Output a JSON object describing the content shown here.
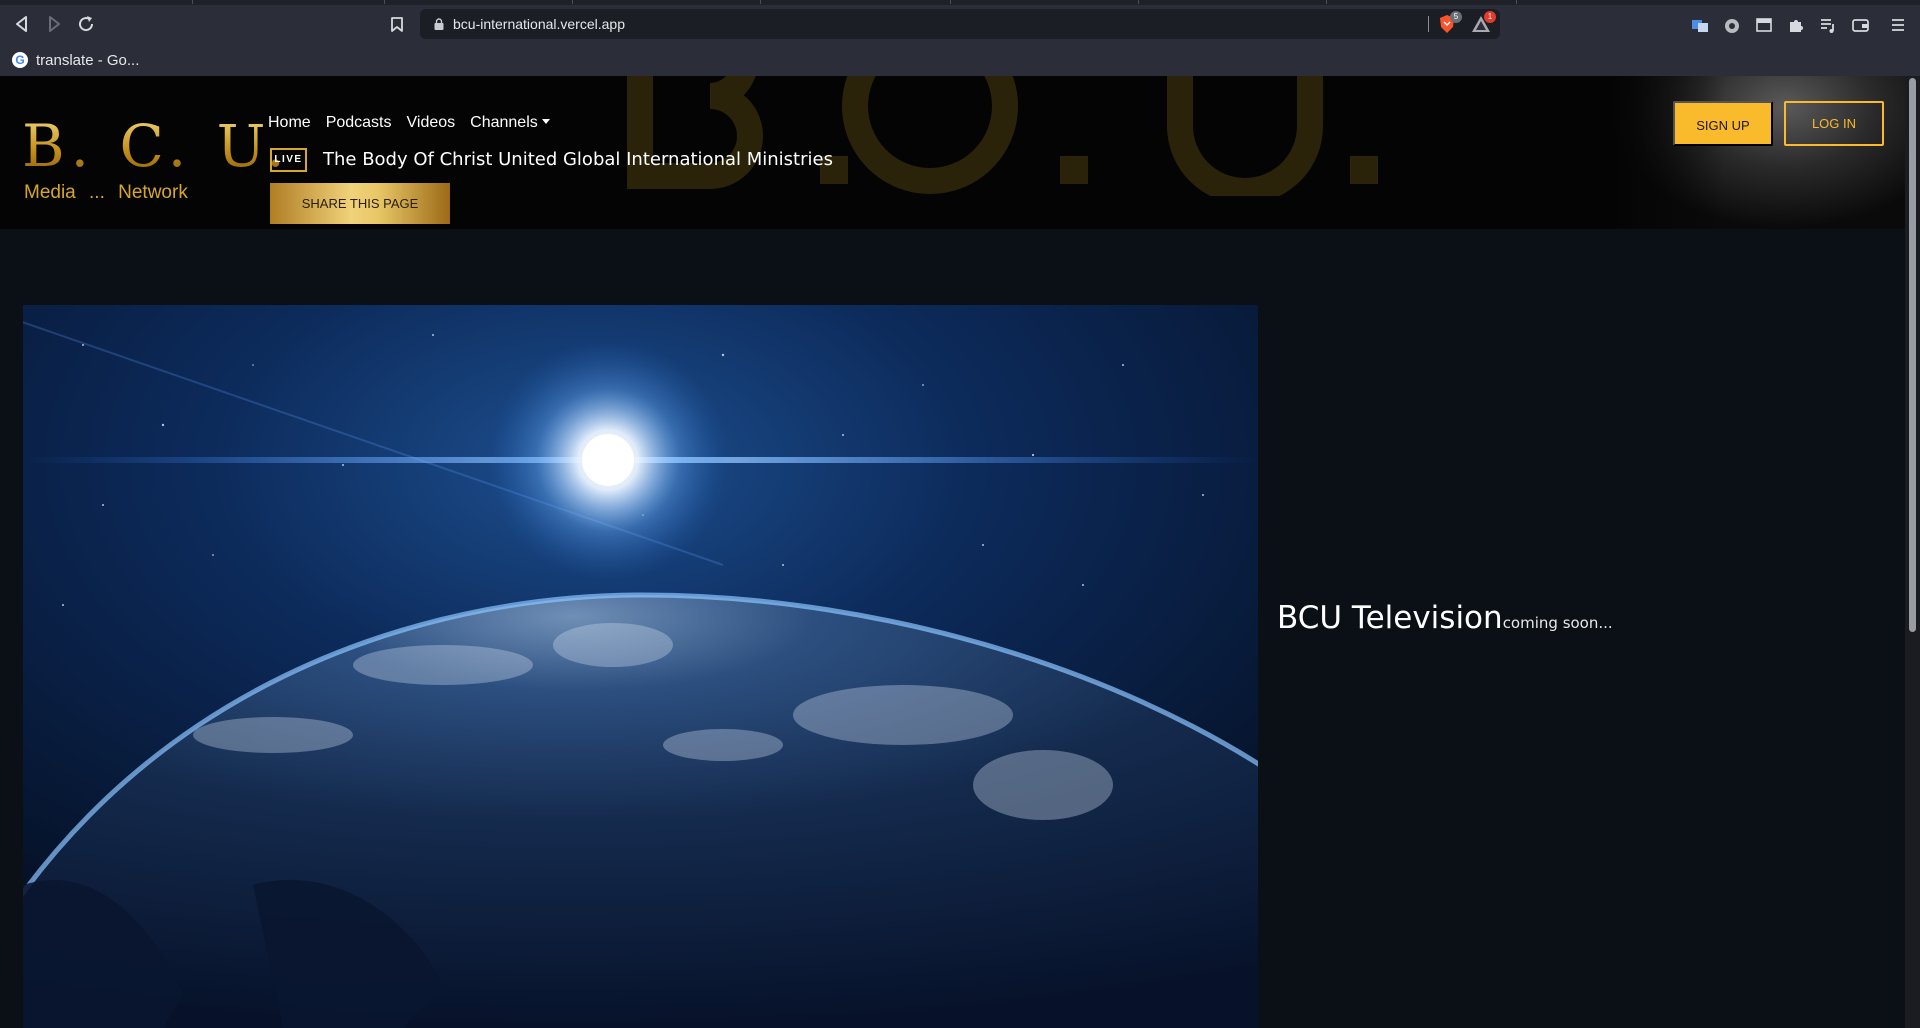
{
  "browser": {
    "url": "bcu-international.vercel.app",
    "bookmark": "translate - Go...",
    "shield_count": "5",
    "rewards_count": "1",
    "brand_color": "#fb542b"
  },
  "site": {
    "logo_line1": "B. C. U.",
    "logo_line2": "Media ... Network",
    "nav": {
      "home": "Home",
      "podcasts": "Podcasts",
      "videos": "Videos",
      "channels": "Channels"
    },
    "live_label": "LIVE",
    "ministry_title": "The Body Of Christ United Global International Ministries",
    "share_label": "SHARE THIS PAGE",
    "signup_label": "SIGN UP",
    "login_label": "LOG IN",
    "accent_color": "#f9bb2b"
  },
  "main": {
    "tv_title": "BCU Television",
    "tv_subtitle": "coming soon..."
  }
}
